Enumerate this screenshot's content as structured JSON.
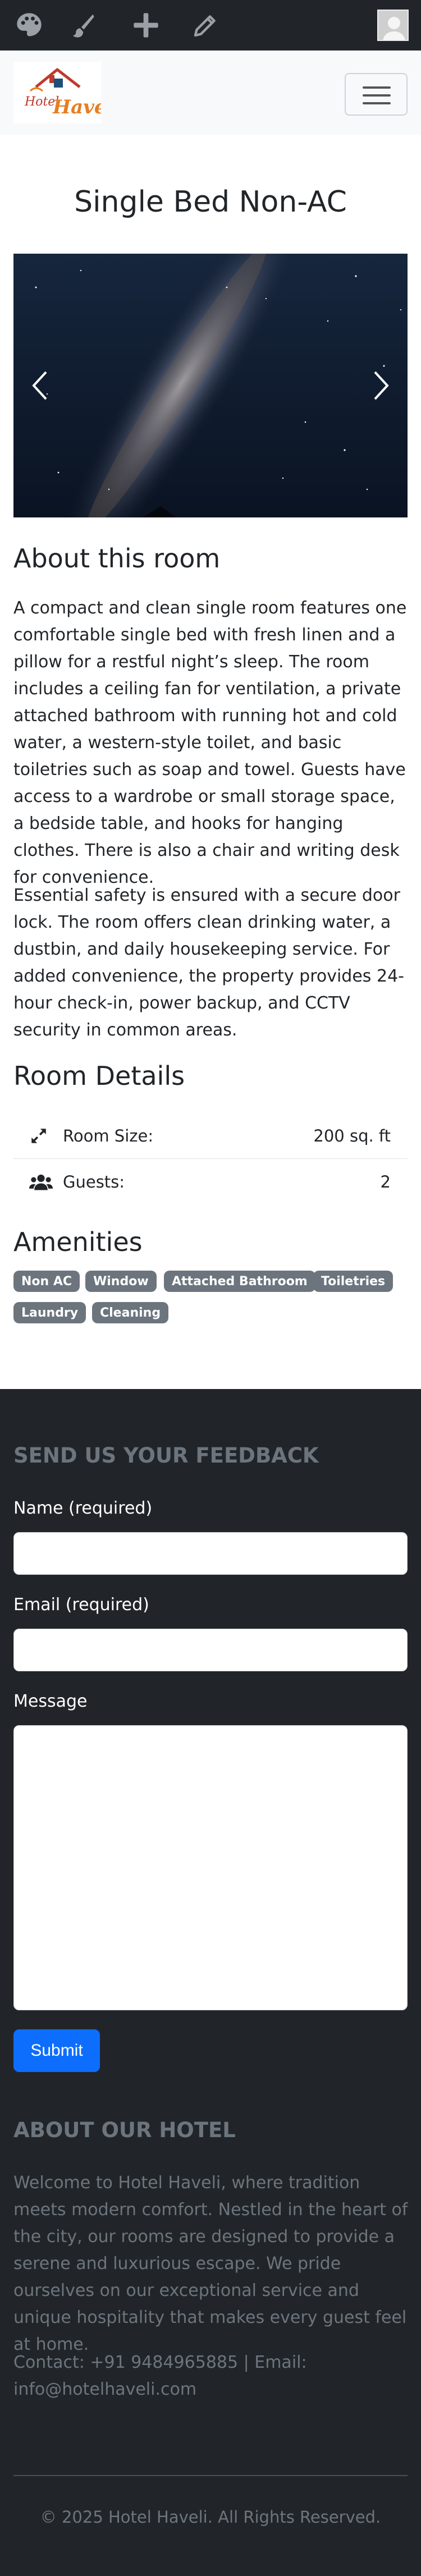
{
  "toolbar": {
    "icons": [
      "palette-icon",
      "brush-icon",
      "plus-icon",
      "pencil-icon"
    ]
  },
  "navbar": {
    "logo_text": "Hotel Haveli"
  },
  "room": {
    "title": "Single Bed Non-AC",
    "about_heading": "About this room",
    "about_p1": "A compact and clean single room features one comfortable single bed with fresh linen and a pillow for a restful night’s sleep. The room includes a ceiling fan for ventilation, a private attached bathroom with running hot and cold water, a western-style toilet, and basic toiletries such as soap and towel. Guests have access to a wardrobe or small storage space, a bedside table, and hooks for hanging clothes. There is also a chair and writing desk for convenience.",
    "about_p2": "Essential safety is ensured with a secure door lock. The room offers clean drinking water, a dustbin, and daily housekeeping service. For added convenience, the property provides 24-hour check-in, power backup, and CCTV security in common areas.",
    "details_heading": "Room Details",
    "details": {
      "size_label": "Room Size:",
      "size_value": "200 sq. ft",
      "guests_label": "Guests:",
      "guests_value": "2"
    },
    "amenities_heading": "Amenities",
    "amenities": [
      "Non AC",
      "Window",
      "Attached Bathroom",
      "Toiletries",
      "Laundry",
      "Cleaning"
    ]
  },
  "footer": {
    "feedback_heading": "SEND US YOUR FEEDBACK",
    "name_label": "Name (required)",
    "email_label": "Email (required)",
    "message_label": "Message",
    "submit_label": "Submit",
    "about_heading": "ABOUT OUR HOTEL",
    "about_text": "Welcome to Hotel Haveli, where tradition meets modern comfort. Nestled in the heart of the city, our rooms are designed to provide a serene and luxurious escape. We pride ourselves on our exceptional service and unique hospitality that makes every guest feel at home.",
    "contact_text": "Contact: +91 9484965885 | Email: info@hotelhaveli.com",
    "copyright": "© 2025 Hotel Haveli. All Rights Reserved."
  },
  "colors": {
    "dark": "#212529",
    "muted": "#6c757d",
    "primary": "#0d6efd",
    "badge": "#6c757d"
  }
}
